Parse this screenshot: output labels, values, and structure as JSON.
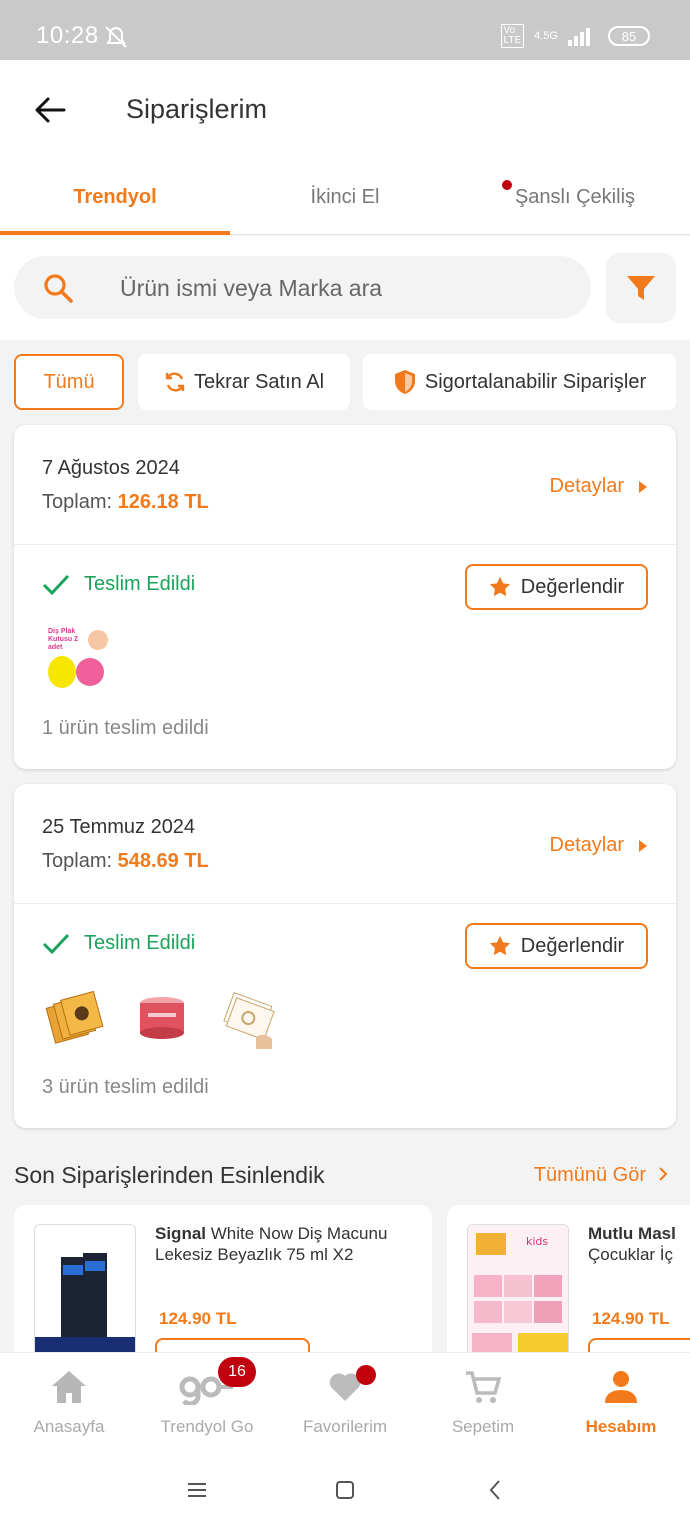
{
  "status_bar": {
    "time": "10:28",
    "battery": "85",
    "network": "4.5G"
  },
  "header": {
    "title": "Siparişlerim"
  },
  "tabs": [
    {
      "label": "Trendyol"
    },
    {
      "label": "İkinci El"
    },
    {
      "label": "Şanslı Çekiliş"
    }
  ],
  "search": {
    "placeholder": "Ürün ismi veya Marka ara"
  },
  "chips": [
    {
      "label": "Tümü"
    },
    {
      "label": "Tekrar Satın Al"
    },
    {
      "label": "Sigortalanabilir Siparişler"
    }
  ],
  "orders": [
    {
      "date": "7 Ağustos 2024",
      "total_label": "Toplam:",
      "total_amount": "126.18 TL",
      "details_label": "Detaylar",
      "status": "Teslim Edildi",
      "rate_label": "Değerlendir",
      "thumb_text": "Diş Plak Kutusu 2 adet",
      "delivered_text": "1 ürün teslim edildi"
    },
    {
      "date": "25 Temmuz 2024",
      "total_label": "Toplam:",
      "total_amount": "548.69 TL",
      "details_label": "Detaylar",
      "status": "Teslim Edildi",
      "rate_label": "Değerlendir",
      "delivered_text": "3 ürün teslim edildi"
    }
  ],
  "inspired": {
    "title": "Son Siparişlerinden Esinlendik",
    "see_all": "Tümünü Gör",
    "items": [
      {
        "brand": "Signal",
        "name": "White Now Diş Macunu Lekesiz Beyazlık 75 ml X2",
        "price": "124.90 TL"
      },
      {
        "brand": "Mutlu Masl",
        "name": "Çocuklar İç",
        "price": "124.90 TL"
      }
    ]
  },
  "bottom_nav": [
    {
      "label": "Anasayfa"
    },
    {
      "label": "Trendyol Go",
      "badge": "16"
    },
    {
      "label": "Favorilerim"
    },
    {
      "label": "Sepetim"
    },
    {
      "label": "Hesabım"
    }
  ],
  "colors": {
    "accent": "#f27a1a",
    "success": "#1aa35a",
    "badge": "#c0000d"
  }
}
